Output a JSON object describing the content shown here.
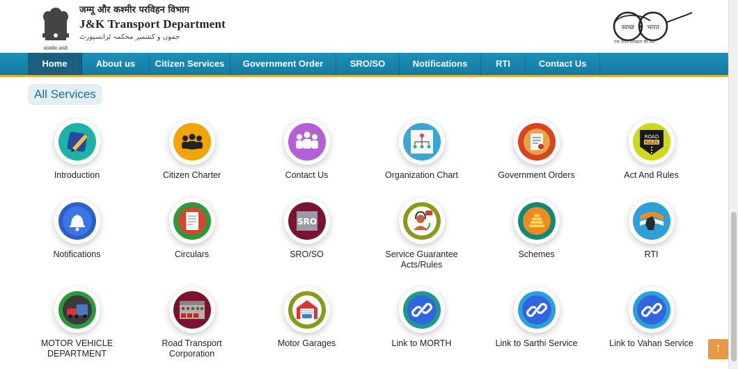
{
  "header": {
    "hindi_title": "जम्मू और कश्मीर परविहन विभाग",
    "title": "J&K Transport Department",
    "urdu_title": "جموں و کشمیر محکمہ ٹرانسپورٹ",
    "emblem_motto": "सत्यमेव जयते",
    "swachh_left": "स्वच्छ",
    "swachh_right": "भारत",
    "swachh_caption": "एक कदम स्वच्छता की ओर"
  },
  "nav": {
    "items": [
      {
        "label": "Home"
      },
      {
        "label": "About us"
      },
      {
        "label": "Citizen Services"
      },
      {
        "label": "Government Order"
      },
      {
        "label": "SRO/SO"
      },
      {
        "label": "Notifications"
      },
      {
        "label": "RTI"
      },
      {
        "label": "Contact Us"
      }
    ]
  },
  "main": {
    "section_title": "All Services",
    "services": [
      {
        "label": "Introduction",
        "icon": "pen-icon",
        "color": "#1bb3a8"
      },
      {
        "label": "Citizen Charter",
        "icon": "people-group-icon",
        "color": "#f0a500"
      },
      {
        "label": "Contact Us",
        "icon": "team-icon",
        "color": "#b45fd6"
      },
      {
        "label": "Organization Chart",
        "icon": "org-chart-icon",
        "color": "#3aa6d8"
      },
      {
        "label": "Government Orders",
        "icon": "document-icon",
        "color": "#d9431f"
      },
      {
        "label": "Act And Rules",
        "icon": "road-rules-icon",
        "color": "#cfd81a"
      },
      {
        "label": "Notifications",
        "icon": "bell-icon",
        "color": "#2e5fc6"
      },
      {
        "label": "Circulars",
        "icon": "circular-doc-icon",
        "color": "#2a9a3a"
      },
      {
        "label": "SRO/SO",
        "icon": "sro-icon",
        "color": "#7a1330"
      },
      {
        "label": "Service Guarantee\nActs/Rules",
        "icon": "support-agent-icon",
        "color": "#8a9a18"
      },
      {
        "label": "Schemes",
        "icon": "coins-icon",
        "color": "#10887a"
      },
      {
        "label": "RTI",
        "icon": "rti-hand-icon",
        "color": "#2ca0d8"
      },
      {
        "label": "MOTOR VEHICLE\nDEPARTMENT",
        "icon": "vehicles-icon",
        "color": "#2a9a3a"
      },
      {
        "label": "Road Transport\nCorporation",
        "icon": "building-icon",
        "color": "#7a1330"
      },
      {
        "label": "Motor Garages",
        "icon": "garage-icon",
        "color": "#8a9a18"
      },
      {
        "label": "Link to MORTH",
        "icon": "link-icon",
        "color": "#1f9a8a"
      },
      {
        "label": "Link to Sarthi Service",
        "icon": "link-icon",
        "color": "#2ca0d8"
      },
      {
        "label": "Link to Vahan Service",
        "icon": "link-icon",
        "color": "#2ca0d8"
      }
    ]
  },
  "back_to_top": "↑",
  "colors": {
    "nav_bg": "#1a86b0",
    "nav_active": "#1b5f7e",
    "nav_border": "#e8b23a",
    "section_title": "#1a6f8f",
    "link_blue": "#2f66e0"
  }
}
